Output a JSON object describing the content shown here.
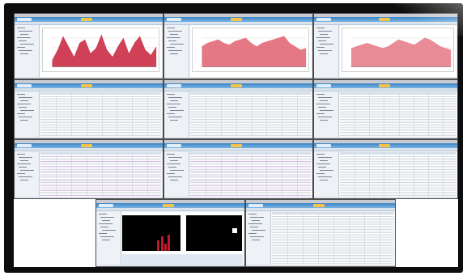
{
  "display": {
    "description": "",
    "screens": [
      {
        "id": "s1",
        "kind": "chart",
        "series": [
          0.2,
          0.5,
          0.9,
          0.6,
          0.3,
          0.7,
          0.8,
          0.4,
          0.55,
          0.95,
          0.5,
          0.3,
          0.6,
          0.85,
          0.4,
          0.7,
          0.9,
          0.5,
          0.35,
          0.6
        ],
        "fill": "#c8203a"
      },
      {
        "id": "s2",
        "kind": "chart",
        "series": [
          0.6,
          0.7,
          0.75,
          0.8,
          0.7,
          0.65,
          0.75,
          0.8,
          0.85,
          0.7,
          0.6,
          0.7,
          0.75,
          0.8,
          0.85,
          0.9,
          0.7,
          0.6,
          0.5,
          0.55
        ],
        "fill": "#e06070"
      },
      {
        "id": "s3",
        "kind": "chart",
        "series": [
          0.55,
          0.6,
          0.65,
          0.7,
          0.65,
          0.6,
          0.55,
          0.6,
          0.7,
          0.8,
          0.75,
          0.7,
          0.65,
          0.75,
          0.85,
          0.8,
          0.7,
          0.6,
          0.55,
          0.5
        ],
        "fill": "#e57885"
      },
      {
        "id": "s4",
        "kind": "table"
      },
      {
        "id": "s5",
        "kind": "table"
      },
      {
        "id": "s6",
        "kind": "table"
      },
      {
        "id": "s7",
        "kind": "table"
      },
      {
        "id": "s8",
        "kind": "table"
      },
      {
        "id": "s9",
        "kind": "table"
      },
      {
        "id": "s10",
        "kind": "console"
      },
      {
        "id": "s11",
        "kind": "table"
      }
    ],
    "colors": {
      "bezel": "#0d0d0d",
      "banner": "#3b84c6",
      "accent_red": "#c8203a",
      "table_header": "#d7dfe9"
    }
  }
}
